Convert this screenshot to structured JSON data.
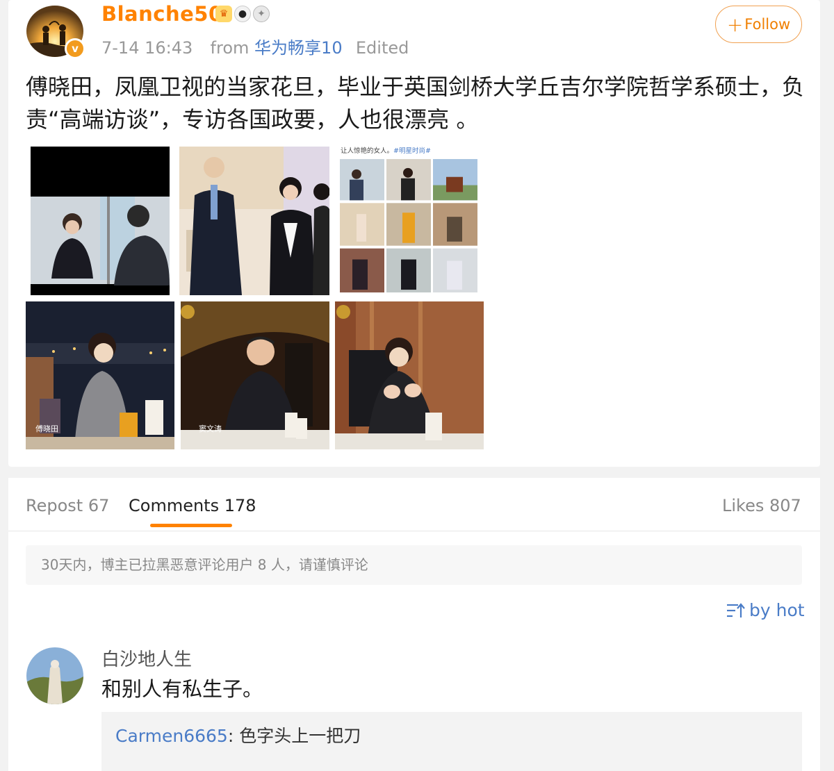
{
  "post": {
    "username": "Blanche50",
    "user_badges": [
      "crown-badge",
      "panda-badge",
      "medal-badge"
    ],
    "verified_badge": "v",
    "time": "7-14 16:43",
    "from_label": "from",
    "source": "华为畅享10",
    "edited": "Edited",
    "follow_label": "Follow",
    "text": "傅晓田，凤凰卫视的当家花旦，毕业于英国剑桥大学丘吉尔学院哲学系硕士，负责“高端访谈”，专访各国政要，人也很漂亮 。",
    "collage_caption": "让人惊艳的女人。",
    "collage_hashtag": "#明星时尚#",
    "caption_photo7": "傅晓田",
    "caption_photo8": "窦文涛"
  },
  "tabs": {
    "repost": "Repost 67",
    "comments": "Comments 178",
    "likes": "Likes 807"
  },
  "notice": "30天内，博主已拉黑恶意评论用户 8 人，请谨慎评论",
  "sort_label": "by hot",
  "comment": {
    "user": "白沙地人生",
    "text": "和别人有私生子。",
    "reply_user": "Carmen6665",
    "reply_text": "色字头上一把刀"
  },
  "colors": {
    "accent": "#ff8200",
    "link": "#4a7cc7",
    "muted": "#999999"
  }
}
